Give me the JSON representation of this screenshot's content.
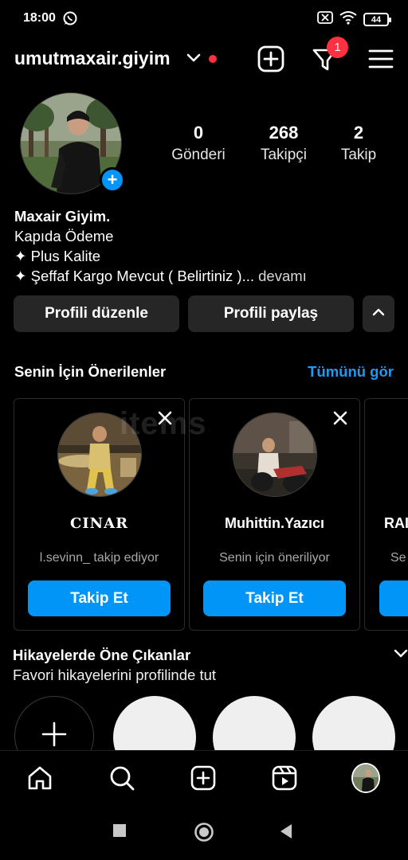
{
  "status_bar": {
    "time": "18:00",
    "battery": "44"
  },
  "header": {
    "username": "umutmaxair.giyim",
    "notification_count": "1"
  },
  "stats": [
    {
      "value": "0",
      "label": "Gönderi"
    },
    {
      "value": "268",
      "label": "Takipçi"
    },
    {
      "value": "2",
      "label": "Takip"
    }
  ],
  "bio": {
    "name": "Maxair Giyim.",
    "line1": "Kapıda Ödeme",
    "line2": "✦ Plus Kalite",
    "line3": "✦ Şeffaf Kargo Mevcut ( Belirtiniz )...",
    "more": "devamı"
  },
  "buttons": {
    "edit_profile": "Profili düzenle",
    "share_profile": "Profili paylaş"
  },
  "suggestions": {
    "title": "Senin İçin Önerilenler",
    "see_all": "Tümünü gör",
    "cards": [
      {
        "name": "CINAR",
        "subtitle": "l.sevinn_ takip ediyor",
        "button": "Takip Et"
      },
      {
        "name": "Muhittin.Yazıcı",
        "subtitle": "Senin için öneriliyor",
        "button": "Takip Et"
      },
      {
        "name": "RAI",
        "subtitle": "Se"
      }
    ]
  },
  "highlights": {
    "title": "Hikayelerde Öne Çıkanlar",
    "subtitle": "Favori hikayelerini profilinde tut"
  },
  "watermark": "items"
}
